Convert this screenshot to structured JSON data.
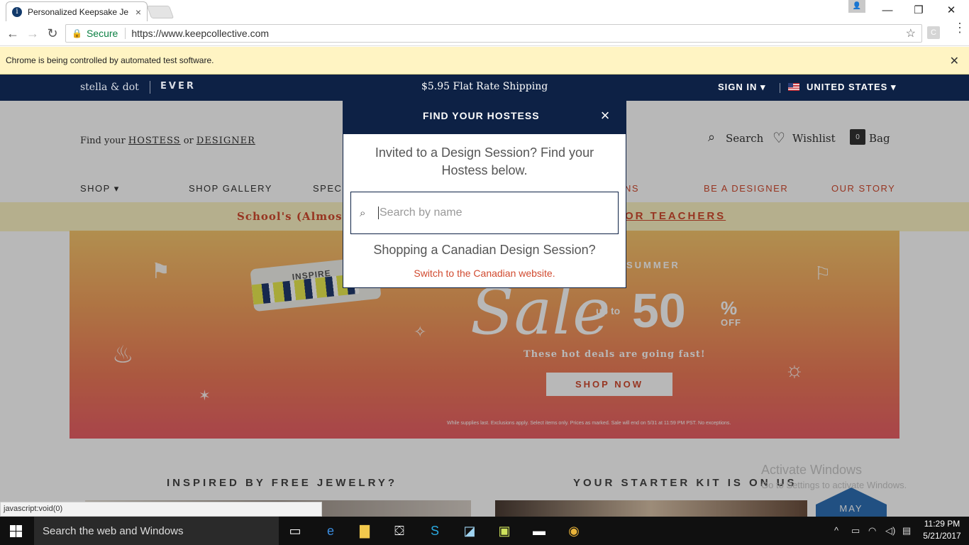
{
  "browser": {
    "tab_title": "Personalized Keepsake Je",
    "tab_close": "×",
    "secure_label": "Secure",
    "url": "https://www.keepcollective.com",
    "infobar_text": "Chrome is being controlled by automated test software.",
    "extension_letter": "C",
    "status_text": "javascript:void(0)"
  },
  "site": {
    "brand_left": "stella & dot",
    "brand_right": "EVER",
    "shipping_text": "$5.95 Flat Rate Shipping",
    "sign_in": "SIGN IN ▾",
    "country": "UNITED STATES ▾",
    "find_prefix": "Find your",
    "find_hostess": "HOSTESS",
    "find_or": "or",
    "find_designer": "DESIGNER",
    "search_label": "Search",
    "wishlist_label": "Wishlist",
    "bag_label": "Bag",
    "bag_count": "0",
    "nav": {
      "shop": "SHOP ▾",
      "gallery": "SHOP GALLERY",
      "specials": "SPECI",
      "ns": "NS",
      "be_designer": "BE A DESIGNER",
      "our_story": "OUR STORY"
    },
    "promo_left": "School's (Almost)",
    "promo_right": "OR TEACHERS",
    "hero": {
      "inspire": "INSPIRE",
      "summer": "SUMMER",
      "sale": "Sale",
      "up_to": "up to",
      "percent": "50",
      "percent_sign": "%",
      "off": "OFF",
      "tagline": "These hot deals are going fast!",
      "cta": "SHOP NOW",
      "fine_print": "While supplies last. Exclusions apply. Select items only. Prices as marked. Sale will end on 5/31 at 11:59 PM PST. No exceptions."
    },
    "section_left": "INSPIRED BY FREE JEWELRY?",
    "section_right": "YOUR STARTER KIT IS ON US",
    "may_badge": "MAY",
    "activate_title": "Activate Windows",
    "activate_sub": "Go to Settings to activate Windows."
  },
  "modal": {
    "title": "FIND YOUR HOSTESS",
    "close": "×",
    "invite_text": "Invited to a Design Session? Find your Hostess below.",
    "search_placeholder": "Search by name",
    "canada_text": "Shopping a Canadian Design Session?",
    "switch_link": "Switch to the Canadian website."
  },
  "taskbar": {
    "search_placeholder": "Search the web and Windows",
    "time": "11:29 PM",
    "date": "5/21/2017"
  },
  "colors": {
    "navy": "#0d2145",
    "accent_red": "#d14a2f",
    "infobar_yellow": "#fff4c3"
  }
}
